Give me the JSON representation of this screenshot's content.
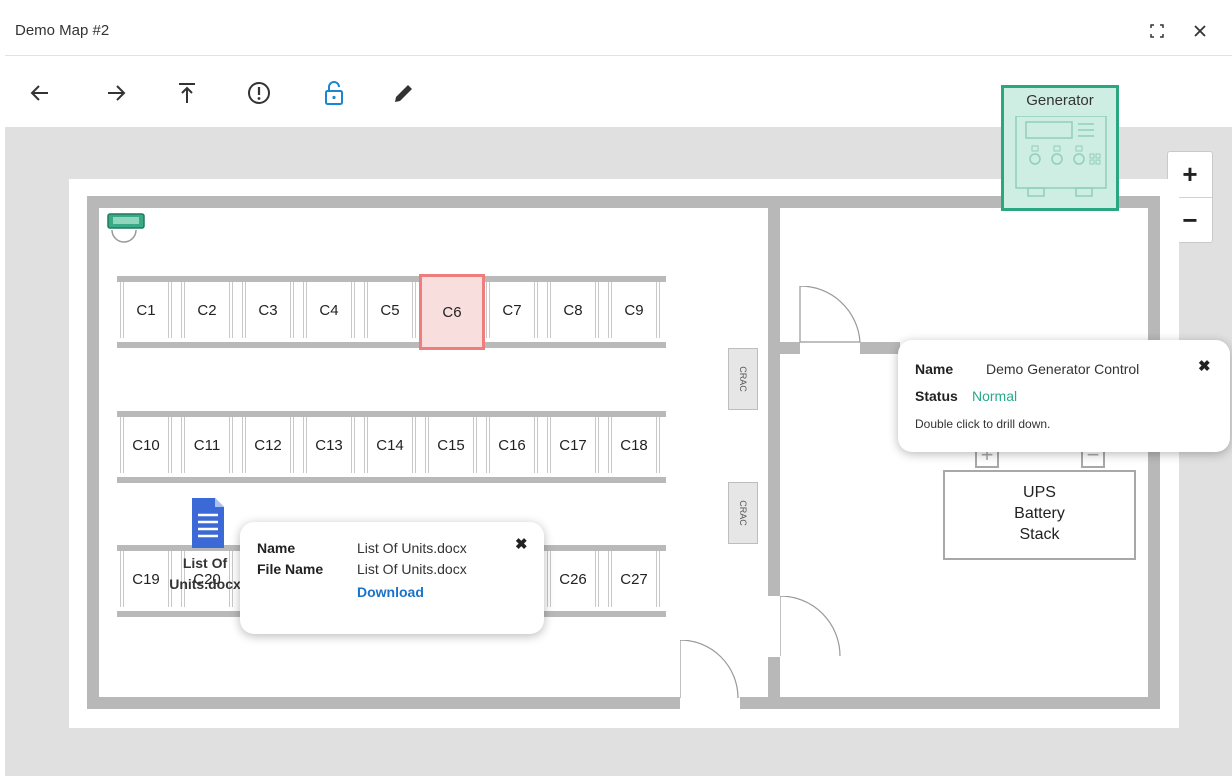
{
  "window": {
    "title": "Demo Map #2"
  },
  "toolbar": {
    "tools": [
      "back-icon",
      "forward-icon",
      "top-level-icon",
      "alert-icon",
      "unlock-icon",
      "edit-icon"
    ],
    "unlock_color": "#1a86d0"
  },
  "zoom": {
    "in_label": "+",
    "out_label": "−"
  },
  "racks": {
    "row1": [
      "C1",
      "C2",
      "C3",
      "C4",
      "C5",
      "C6",
      "C7",
      "C8",
      "C9"
    ],
    "row2": [
      "C10",
      "C11",
      "C12",
      "C13",
      "C14",
      "C15",
      "C16",
      "C17",
      "C18"
    ],
    "row3_left": [
      "C19",
      "C20"
    ],
    "row3_right": [
      "C26",
      "C27"
    ],
    "selected": "C6"
  },
  "crac": {
    "unit1": "CRAC",
    "unit2": "CRAC"
  },
  "generator": {
    "label": "Generator",
    "color": "#2aa680"
  },
  "ups": {
    "line1": "UPS",
    "line2": "Battery",
    "line3": "Stack"
  },
  "document": {
    "line1": "List Of",
    "line2": "Units.docx",
    "icon_color": "#3b6ad6"
  },
  "file_popup": {
    "name_label": "Name",
    "name_value": "List Of Units.docx",
    "file_name_label": "File Name",
    "file_name_value": "List Of Units.docx",
    "download_label": "Download",
    "close_icon": "✖",
    "link_color": "#1a73c8"
  },
  "gen_popup": {
    "name_label": "Name",
    "name_value": "Demo Generator Control",
    "status_label": "Status",
    "status_value": "Normal",
    "status_color": "#27a88a",
    "hint": "Double click to drill down.",
    "close_icon": "✖"
  }
}
